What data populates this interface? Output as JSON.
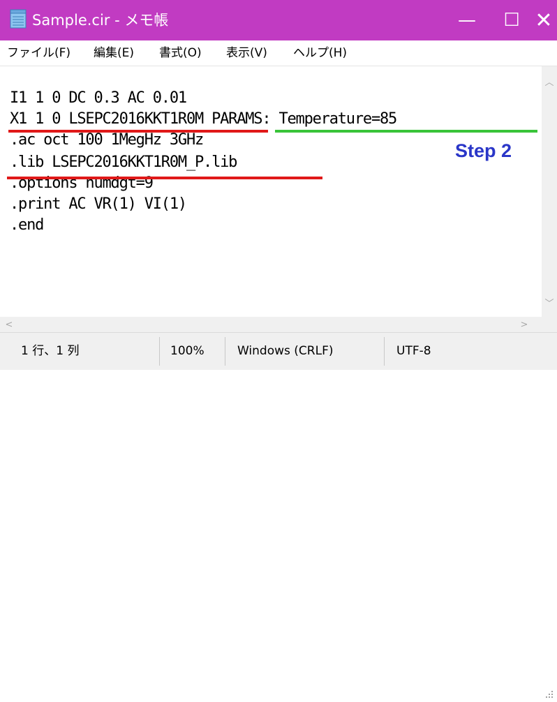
{
  "window": {
    "title": "Sample.cir - メモ帳",
    "minimize_glyph": "—",
    "maximize_glyph": "☐",
    "close_glyph": "✕"
  },
  "menu": {
    "items": [
      {
        "label": "ファイル(F)"
      },
      {
        "label": "編集(E)"
      },
      {
        "label": "書式(O)"
      },
      {
        "label": "表示(V)"
      },
      {
        "label": "ヘルプ(H)"
      }
    ]
  },
  "editor": {
    "lines": [
      "I1 1 0 DC 0.3 AC 0.01",
      "X1 1 0 LSEPC2016KKT1R0M PARAMS: Temperature=85",
      ".ac oct 100 1MegHz 3GHz",
      ".lib LSEPC2016KKT1R0M_P.lib",
      ".options numdgt=9",
      ".print AC VR(1) VI(1)",
      ".end"
    ],
    "annotation": "Step 2"
  },
  "status": {
    "position": "1 行、1 列",
    "zoom": "100%",
    "line_ending": "Windows (CRLF)",
    "encoding": "UTF-8"
  },
  "colors": {
    "titlebar": "#c13bc2",
    "underline_red": "#e01919",
    "underline_green": "#3ac43a",
    "annotation_blue": "#2a36c8"
  },
  "icons": {
    "app": "notepad-icon",
    "scroll_up": "scroll-up-arrow-icon",
    "scroll_down": "scroll-down-arrow-icon",
    "scroll_left": "scroll-left-arrow-icon",
    "scroll_right": "scroll-right-arrow-icon"
  }
}
